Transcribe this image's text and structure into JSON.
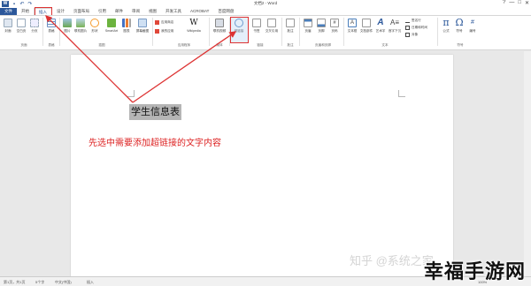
{
  "titlebar": {
    "app_icon": "W",
    "qat_icons": [
      "save-icon",
      "undo-icon",
      "redo-icon"
    ],
    "title": "文档2 - Word",
    "controls": [
      "?",
      "—",
      "□",
      "✕"
    ]
  },
  "tabs": [
    {
      "label": "文件"
    },
    {
      "label": "开始"
    },
    {
      "label": "插入"
    },
    {
      "label": "设计"
    },
    {
      "label": "页面布局"
    },
    {
      "label": "引用"
    },
    {
      "label": "邮件"
    },
    {
      "label": "审阅"
    },
    {
      "label": "视图"
    },
    {
      "label": "开发工具"
    },
    {
      "label": "ACROBAT"
    },
    {
      "label": "百度网盘"
    }
  ],
  "ribbon": {
    "pages": {
      "cover": "封面",
      "blank": "空白页",
      "break": "分页"
    },
    "table": "表格",
    "illus": {
      "picture": "图片",
      "online_picture": "联机图片",
      "shapes": "形状",
      "smartart": "SmartArt",
      "chart": "图表",
      "screenshot": "屏幕截图"
    },
    "apps": {
      "store": "应用商店",
      "myapps": "我的应用"
    },
    "wikipedia": "Wikipedia",
    "media": "联机视频",
    "links": {
      "hyperlink": "超链接",
      "bookmark": "书签",
      "crossref": "交叉引用"
    },
    "comment": "批注",
    "header": {
      "h": "页眉",
      "f": "页脚",
      "num": "页码"
    },
    "text": {
      "textbox": "文本框",
      "quickparts": "文档部件",
      "wordart": "艺术字",
      "dropcap": "首字下沉",
      "sigline": "签名行",
      "datetime": "日期和时间",
      "object": "对象"
    },
    "symbols": {
      "equation": "公式",
      "symbol": "符号",
      "number": "编号"
    },
    "group_labels": {
      "pages": "页面",
      "tables": "表格",
      "illus": "插图",
      "apps": "应用程序",
      "media": "媒体",
      "links": "链接",
      "comments": "批注",
      "hf": "页眉和页脚",
      "text": "文本",
      "symbols": "符号"
    }
  },
  "document": {
    "selected_text": "学生信息表",
    "instruction": "先选中需要添加超链接的文字内容"
  },
  "statusbar": {
    "page": "第1页，共1页",
    "words": "5个字",
    "lang": "中文(中国)",
    "mode": "插入",
    "zoom": "100%"
  },
  "overlay": {
    "watermark": "知乎 @系统之家",
    "brand": "幸福手游网"
  },
  "colors": {
    "accent": "#2b579a",
    "highlight": "#dd3333",
    "instruction": "#dd2222"
  }
}
